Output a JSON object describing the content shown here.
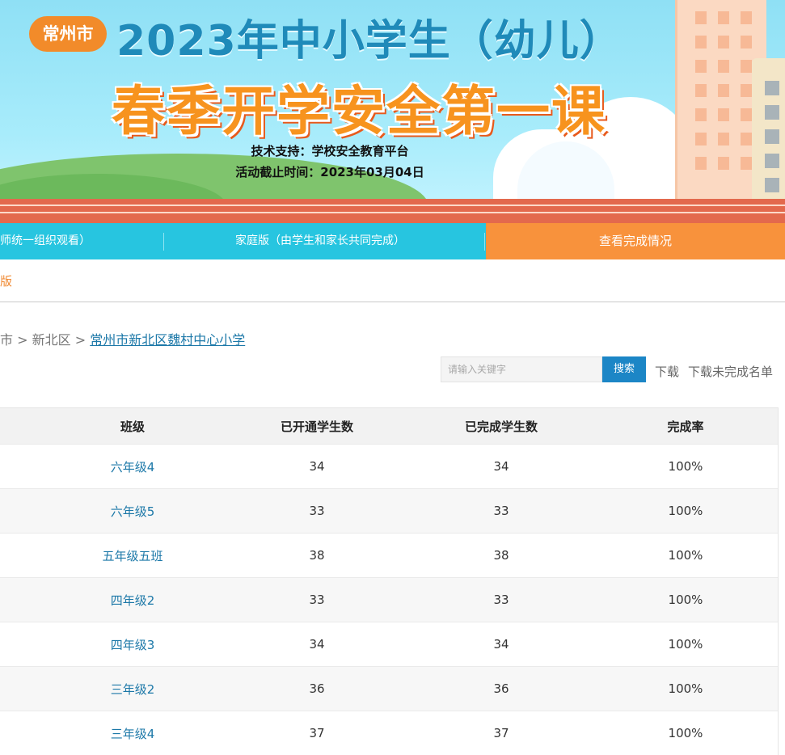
{
  "banner": {
    "city_badge": "常州市",
    "title_line1": "2023年中小学生（幼儿）",
    "title_line2": "春季开学安全第一课",
    "support": "技术支持：学校安全教育平台",
    "deadline": "活动截止时间：2023年03月04日"
  },
  "nav": {
    "items": [
      {
        "label": "师统一组织观看）"
      },
      {
        "label": "家庭版（由学生和家长共同完成）"
      },
      {
        "label": "查看完成情况"
      }
    ],
    "active_color": "#f8923c",
    "bar_color": "#27c5e0"
  },
  "subtab": {
    "label": "版"
  },
  "breadcrumb": {
    "city": "市",
    "district": "新北区",
    "school": "常州市新北区魏村中心小学"
  },
  "search": {
    "placeholder": "请输入关键字",
    "button": "搜索",
    "download": "下载",
    "download_incomplete": "下载未完成名单"
  },
  "table": {
    "headers": [
      "班级",
      "已开通学生数",
      "已完成学生数",
      "完成率"
    ],
    "rows": [
      {
        "class": "六年级4",
        "opened": "34",
        "completed": "34",
        "rate": "100%"
      },
      {
        "class": "六年级5",
        "opened": "33",
        "completed": "33",
        "rate": "100%"
      },
      {
        "class": "五年级五班",
        "opened": "38",
        "completed": "38",
        "rate": "100%"
      },
      {
        "class": "四年级2",
        "opened": "33",
        "completed": "33",
        "rate": "100%"
      },
      {
        "class": "四年级3",
        "opened": "34",
        "completed": "34",
        "rate": "100%"
      },
      {
        "class": "三年级2",
        "opened": "36",
        "completed": "36",
        "rate": "100%"
      },
      {
        "class": "三年级4",
        "opened": "37",
        "completed": "37",
        "rate": "100%"
      }
    ]
  }
}
